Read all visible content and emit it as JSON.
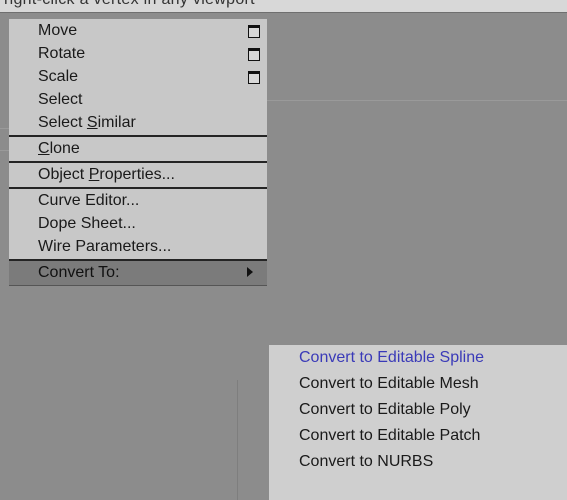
{
  "top_strip": {
    "text": "right-click a vertex in any viewport"
  },
  "quad_menu": {
    "items": [
      {
        "label_pre": "Move",
        "label_u": "",
        "label_post": "",
        "has_box": true
      },
      {
        "label_pre": "Rotate",
        "label_u": "",
        "label_post": "",
        "has_box": true
      },
      {
        "label_pre": "Scale",
        "label_u": "",
        "label_post": "",
        "has_box": true
      },
      {
        "label_pre": "Select",
        "label_u": "",
        "label_post": "",
        "has_box": false
      },
      {
        "label_pre": "Select ",
        "label_u": "S",
        "label_post": "imilar",
        "has_box": false
      },
      {
        "label_pre": "",
        "label_u": "C",
        "label_post": "lone",
        "has_box": false
      },
      {
        "label_pre": "Object ",
        "label_u": "P",
        "label_post": "roperties...",
        "has_box": false
      },
      {
        "label_pre": "Curve Editor...",
        "label_u": "",
        "label_post": "",
        "has_box": false
      },
      {
        "label_pre": "Dope Sheet...",
        "label_u": "",
        "label_post": "",
        "has_box": false
      },
      {
        "label_pre": "Wire Parameters...",
        "label_u": "",
        "label_post": "",
        "has_box": false
      },
      {
        "label_pre": "Convert To:",
        "label_u": "",
        "label_post": "",
        "has_box": false,
        "has_submenu": true,
        "highlighted": true
      }
    ]
  },
  "convert_submenu": {
    "items": [
      {
        "label": "Convert to Editable Spline",
        "active": true
      },
      {
        "label": "Convert to Editable Mesh",
        "active": false
      },
      {
        "label": "Convert to Editable Poly",
        "active": false
      },
      {
        "label": "Convert to Editable Patch",
        "active": false
      },
      {
        "label": "Convert to NURBS",
        "active": false
      }
    ]
  },
  "colors": {
    "menu_bg": "#c8c8c8",
    "highlight_bg": "#7b7b7b",
    "active_text": "#3a3ab8",
    "viewport_bg": "#8c8c8c"
  }
}
